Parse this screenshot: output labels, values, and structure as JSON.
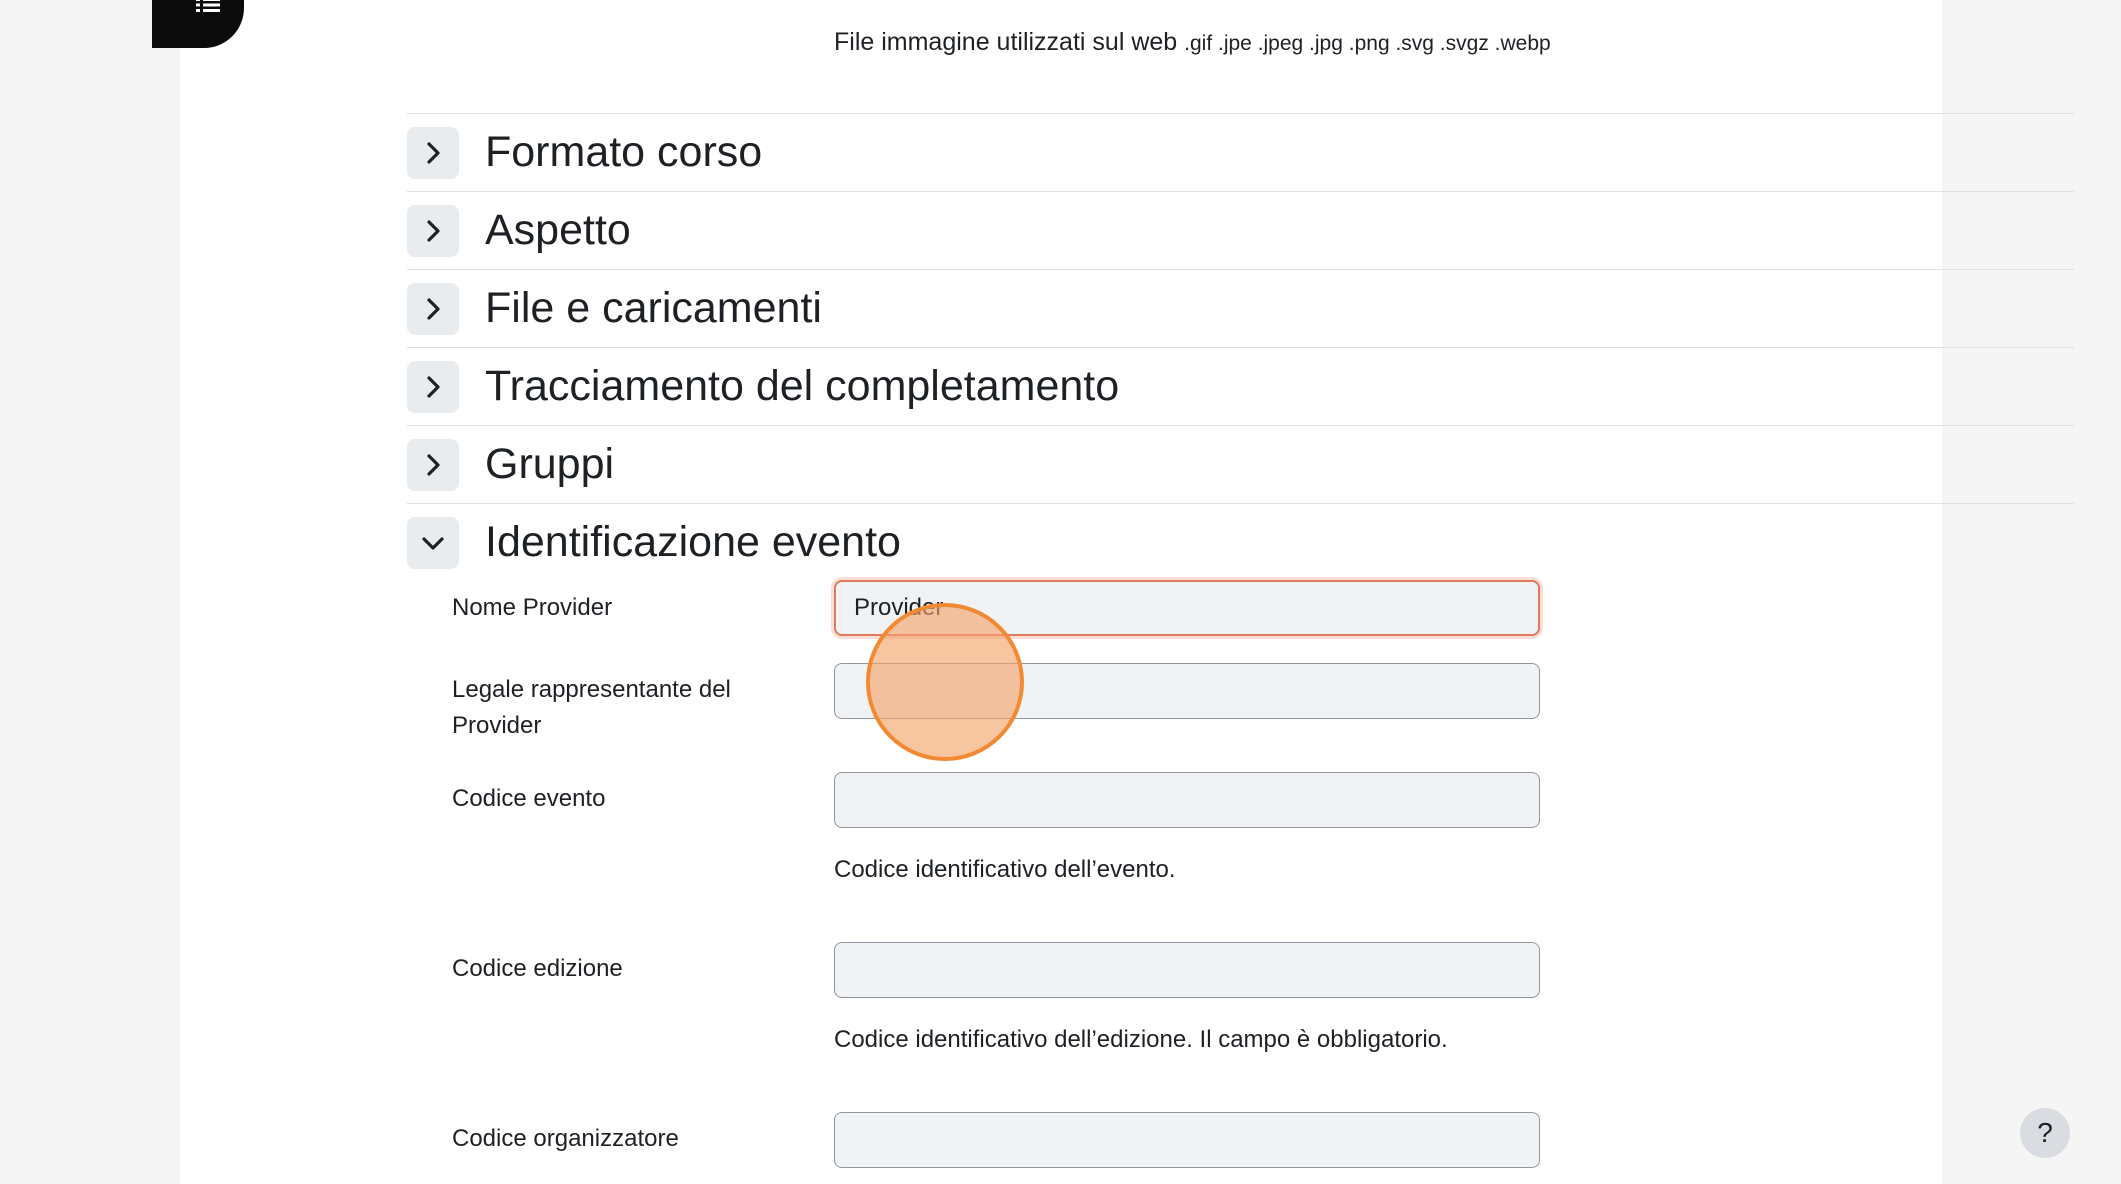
{
  "filetypes": {
    "label": "File immagine utilizzati sul web",
    "extensions": ".gif .jpe .jpeg .jpg .png .svg .svgz .webp"
  },
  "sections": [
    {
      "title": "Formato corso",
      "expanded": false
    },
    {
      "title": "Aspetto",
      "expanded": false
    },
    {
      "title": "File e caricamenti",
      "expanded": false
    },
    {
      "title": "Tracciamento del completamento",
      "expanded": false
    },
    {
      "title": "Gruppi",
      "expanded": false
    },
    {
      "title": "Identificazione evento",
      "expanded": true
    }
  ],
  "form": {
    "nome_provider": {
      "label": "Nome Provider",
      "value": "Provider"
    },
    "legale_rappresentante": {
      "label": "Legale rappresentante del Provider",
      "value": ""
    },
    "codice_evento": {
      "label": "Codice evento",
      "value": "",
      "help": "Codice identificativo dell’evento."
    },
    "codice_edizione": {
      "label": "Codice edizione",
      "value": "",
      "help": "Codice identificativo dell’edizione. Il campo è obbligatorio."
    },
    "codice_organizzatore": {
      "label": "Codice organizzatore",
      "value": ""
    }
  },
  "help_button": {
    "label": "?"
  },
  "colors": {
    "focus_border": "#e07a5f",
    "click_marker": "#f28a34"
  }
}
